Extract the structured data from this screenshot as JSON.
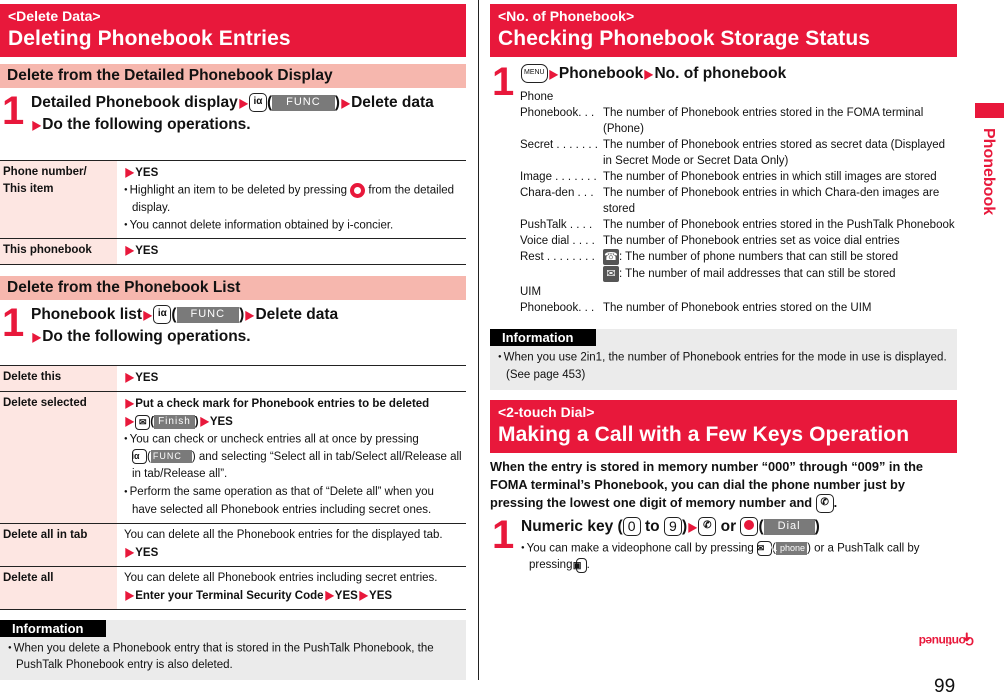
{
  "left": {
    "title": {
      "kicker": "<Delete Data>",
      "main": "Deleting Phonebook Entries"
    },
    "section1": {
      "heading": "Delete from the Detailed Phonebook Display",
      "step_num": "1",
      "step_parts": [
        "Detailed Phonebook display",
        "(",
        "FUNC",
        ")",
        "Delete data",
        "Do the following operations."
      ],
      "rows": [
        {
          "label_lines": [
            "Phone number/",
            "This item"
          ],
          "lines": [
            {
              "type": "bold",
              "text": "YES"
            },
            {
              "type": "bullet",
              "text_a": "Highlight an item to be deleted by pressing ",
              "text_b": " from the detailed display."
            },
            {
              "type": "bullet",
              "text": "You cannot delete information obtained by i-concier."
            }
          ]
        },
        {
          "label_lines": [
            "This phonebook"
          ],
          "lines": [
            {
              "type": "bold",
              "text": "YES"
            }
          ]
        }
      ]
    },
    "section2": {
      "heading": "Delete from the Phonebook List",
      "step_num": "1",
      "step_parts": [
        "Phonebook list",
        "(",
        "FUNC",
        ")",
        "Delete data",
        "Do the following operations."
      ],
      "rows": [
        {
          "label": "Delete this",
          "yes": "YES"
        },
        {
          "label": "Delete selected",
          "action": "Put a check mark for Phonebook entries to be deleted",
          "finish_label": "Finish",
          "yes": "YES",
          "bullet1_a": "You can check or uncheck entries all at once by pressing",
          "bullet1_func": "FUNC",
          "bullet1_b": ") and selecting “Select all in tab/Select all/Release all in tab/Release all”.",
          "bullet2": "Perform the same operation as that of “Delete all” when you have selected all Phonebook entries including secret ones."
        },
        {
          "label": "Delete all in tab",
          "desc": "You can delete all the Phonebook entries for the displayed tab.",
          "yes": "YES"
        },
        {
          "label": "Delete all",
          "desc": "You can delete all Phonebook entries including secret entries.",
          "chain": [
            "Enter your Terminal Security Code",
            "YES",
            "YES"
          ]
        }
      ]
    },
    "info": {
      "tag": "Information",
      "bullets": [
        "When you delete a Phonebook entry that is stored in the PushTalk Phonebook, the PushTalk Phonebook entry is also deleted."
      ]
    }
  },
  "right": {
    "title": {
      "kicker": "<No. of Phonebook>",
      "main": "Checking Phonebook Storage Status"
    },
    "step": {
      "num": "1",
      "menu_key": "MENU",
      "parts": [
        "Phonebook",
        "No. of phonebook"
      ]
    },
    "list": [
      {
        "term": "Phone",
        "def": ""
      },
      {
        "term": "Phonebook. . .",
        "def": "The number of Phonebook entries stored in the FOMA terminal (Phone)"
      },
      {
        "term": "Secret . . . . . . .",
        "def": "The number of Phonebook entries stored as secret data (Displayed in Secret Mode or Secret Data Only)"
      },
      {
        "term": "Image . . . . . . .",
        "def": "The number of Phonebook entries in which still images are stored"
      },
      {
        "term": "Chara-den  . . .",
        "def": "The number of Phonebook entries in which Chara-den images are stored"
      },
      {
        "term": "PushTalk  . . . .",
        "def": "The number of Phonebook entries stored in the PushTalk Phonebook"
      },
      {
        "term": "Voice dial . . . .",
        "def": "The number of Phonebook entries set as voice dial entries"
      }
    ],
    "rest": {
      "term": "Rest  . . . . . . . .",
      "phone_icon": "phone-icon",
      "phone_def": ": The number of phone numbers that can still be stored",
      "mail_icon": "mail-icon",
      "mail_def": ": The number of mail addresses that can still be stored"
    },
    "uim": [
      {
        "term": "UIM",
        "def": ""
      },
      {
        "term": "Phonebook. . .",
        "def": "The number of Phonebook entries stored on the UIM"
      }
    ],
    "info": {
      "tag": "Information",
      "bullets": [
        "When you use 2in1, the number of Phonebook entries for the mode in use is displayed. (See page 453)"
      ]
    },
    "title2": {
      "kicker": "<2-touch Dial>",
      "main": "Making a Call with a Few Keys Operation"
    },
    "lead_a": "When the entry is stored in memory number “000” through “009” in the FOMA terminal’s Phonebook, you can dial the phone number just by pressing the lowest one digit of memory number and",
    "lead_b": ".",
    "step2": {
      "num": "1",
      "parts": [
        "Numeric key (",
        "0",
        "to",
        "9",
        ")",
        "or",
        "(",
        "Dial",
        ")"
      ],
      "bullet_a": "You can make a videophone call by pressing",
      "vphone": "V. phone",
      "bullet_b": ") or a PushTalk call by pressing",
      "bullet_c": "."
    }
  },
  "side_tab": "Phonebook",
  "continued": "Continued",
  "page_number": "99",
  "colors": {
    "accent": "#e8183b",
    "subhead_bg": "#f6b7ae",
    "label_bg": "#fde6e2",
    "info_bg": "#ebebeb"
  }
}
